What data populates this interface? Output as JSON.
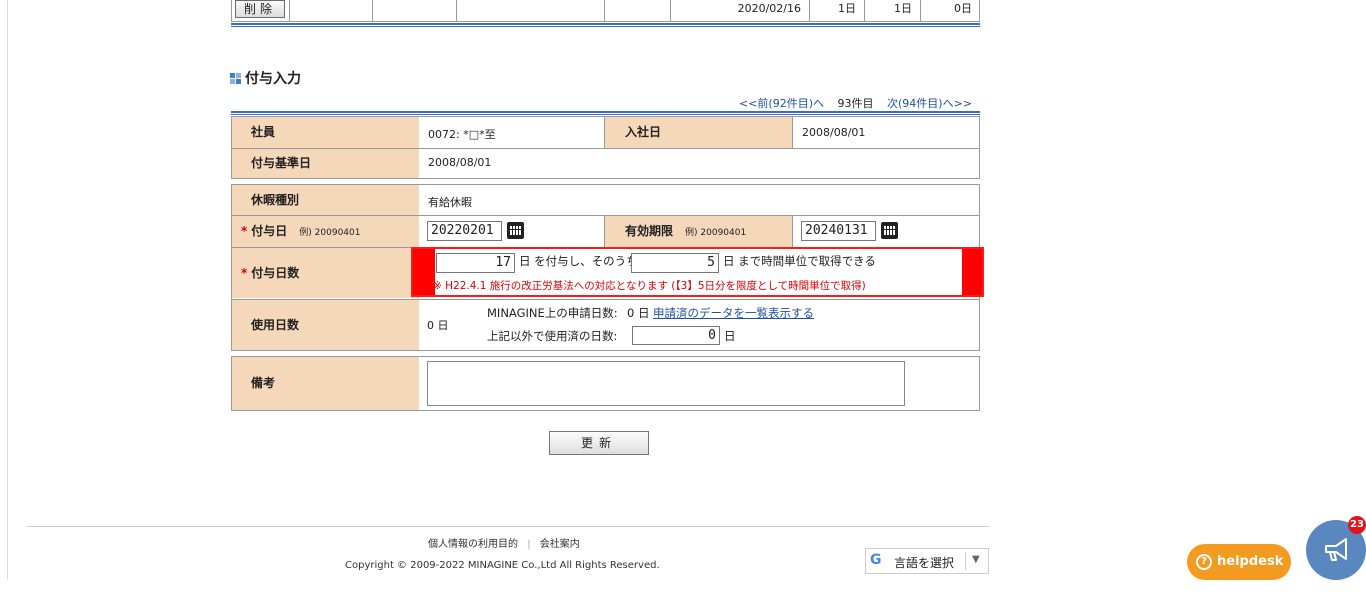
{
  "top_row": {
    "delete_label": "削除",
    "date": "2020/02/16",
    "col1": "1日",
    "col2": "1日",
    "col3": "0日"
  },
  "section": {
    "title": "付与入力"
  },
  "pager": {
    "prev": "<<前(92件目)へ",
    "current": "93件目",
    "next": "次(94件目)へ>>"
  },
  "form": {
    "employee_label": "社員",
    "employee_value": "0072: *□*至",
    "hire_label": "入社日",
    "hire_value": "2008/08/01",
    "base_date_label": "付与基準日",
    "base_date_value": "2008/08/01",
    "leave_type_label": "休暇種別",
    "leave_type_value": "有給休暇",
    "grant_date_label": "付与日",
    "grant_date_example": "例) 20090401",
    "grant_date_value": "20220201",
    "expiry_label": "有効期限",
    "expiry_example": "例) 20090401",
    "expiry_value": "20240131",
    "grant_days_label": "付与日数",
    "grant_days_value": "17",
    "grant_days_text1": "日 を付与し、そのうち",
    "hourly_days_value": "5",
    "grant_days_text2": "日 まで時間単位で取得できる",
    "note": "※ H22.4.1 施行の改正労基法への対応となります (【3】5日分を限度として時間単位で取得)",
    "used_label": "使用日数",
    "used_value": "0 日",
    "minagine_label": "MINAGINE上の申請日数:",
    "minagine_value": "0 日",
    "minagine_link": "申請済のデータを一覧表示する",
    "other_used_label": "上記以外で使用済の日数:",
    "other_used_value": "0",
    "other_used_unit": "日",
    "remarks_label": "備考",
    "remarks_value": "",
    "update_label": "更新"
  },
  "footer": {
    "privacy": "個人情報の利用目的",
    "company": "会社案内",
    "copyright": "Copyright © 2009-2022 MINAGINE Co.,Ltd All Rights Reserved."
  },
  "translate": {
    "label": "言語を選択"
  },
  "helpdesk": {
    "label": "helpdesk"
  },
  "announcements": {
    "count": "23"
  },
  "colors": {
    "label_bg": "#f5d7ba",
    "accent_blue": "#3a6cc6",
    "required_red": "#dd0000",
    "helpdesk_orange": "#f39a1f",
    "announce_blue": "#5a87bf"
  }
}
